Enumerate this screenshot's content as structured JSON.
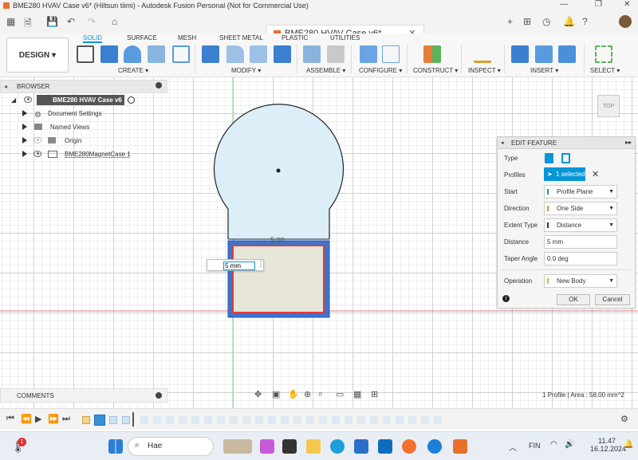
{
  "window": {
    "title": "BME280 HVAV Case v6* (Hiltsun tiimi) - Autodesk Fusion Personal (Not for Commercial Use)",
    "doc_tab": "BME280 HVAV Case v6*"
  },
  "ribbon": {
    "workspace": "DESIGN",
    "tabs": [
      "SOLID",
      "SURFACE",
      "MESH",
      "SHEET METAL",
      "PLASTIC",
      "UTILITIES"
    ],
    "active_tab": "SOLID",
    "groups": [
      "CREATE ▾",
      "MODIFY ▾",
      "ASSEMBLE ▾",
      "CONFIGURE ▾",
      "CONSTRUCT ▾",
      "INSPECT ▾",
      "INSERT ▾",
      "SELECT ▾"
    ]
  },
  "browser": {
    "title": "BROWSER",
    "root": "BME280 HVAV Case v6",
    "items": [
      {
        "label": "Document Settings",
        "icon": "gear-icon"
      },
      {
        "label": "Named Views",
        "icon": "folder-icon"
      },
      {
        "label": "Origin",
        "icon": "folder-icon"
      },
      {
        "label": "BME280MagnetCase 1",
        "icon": "component-icon"
      }
    ]
  },
  "viewcube": {
    "label": "TOP"
  },
  "sketch": {
    "dimension": "5.00",
    "input_value": "5 mm"
  },
  "edit_feature": {
    "title": "EDIT FEATURE",
    "rows": [
      {
        "label": "Type",
        "value": ""
      },
      {
        "label": "Profiles",
        "value": "1 selected"
      },
      {
        "label": "Start",
        "value": "Profile Plane"
      },
      {
        "label": "Direction",
        "value": "One Side"
      },
      {
        "label": "Extent Type",
        "value": "Distance"
      },
      {
        "label": "Distance",
        "value": "5 mm"
      },
      {
        "label": "Taper Angle",
        "value": "0.0 deg"
      },
      {
        "label": "Operation",
        "value": "New Body"
      }
    ],
    "ok": "OK",
    "cancel": "Cancel"
  },
  "comments": {
    "label": "COMMENTS"
  },
  "status": "1 Profile | Area : 58.00 mm^2",
  "taskbar": {
    "search": "Hae",
    "lang": "FIN",
    "time": "11.47",
    "date": "16.12.2024",
    "badge": "1"
  },
  "colors": {
    "accent": "#0696d7",
    "extrude": "#3b74d0",
    "sketch_fill": "#dceef8"
  }
}
